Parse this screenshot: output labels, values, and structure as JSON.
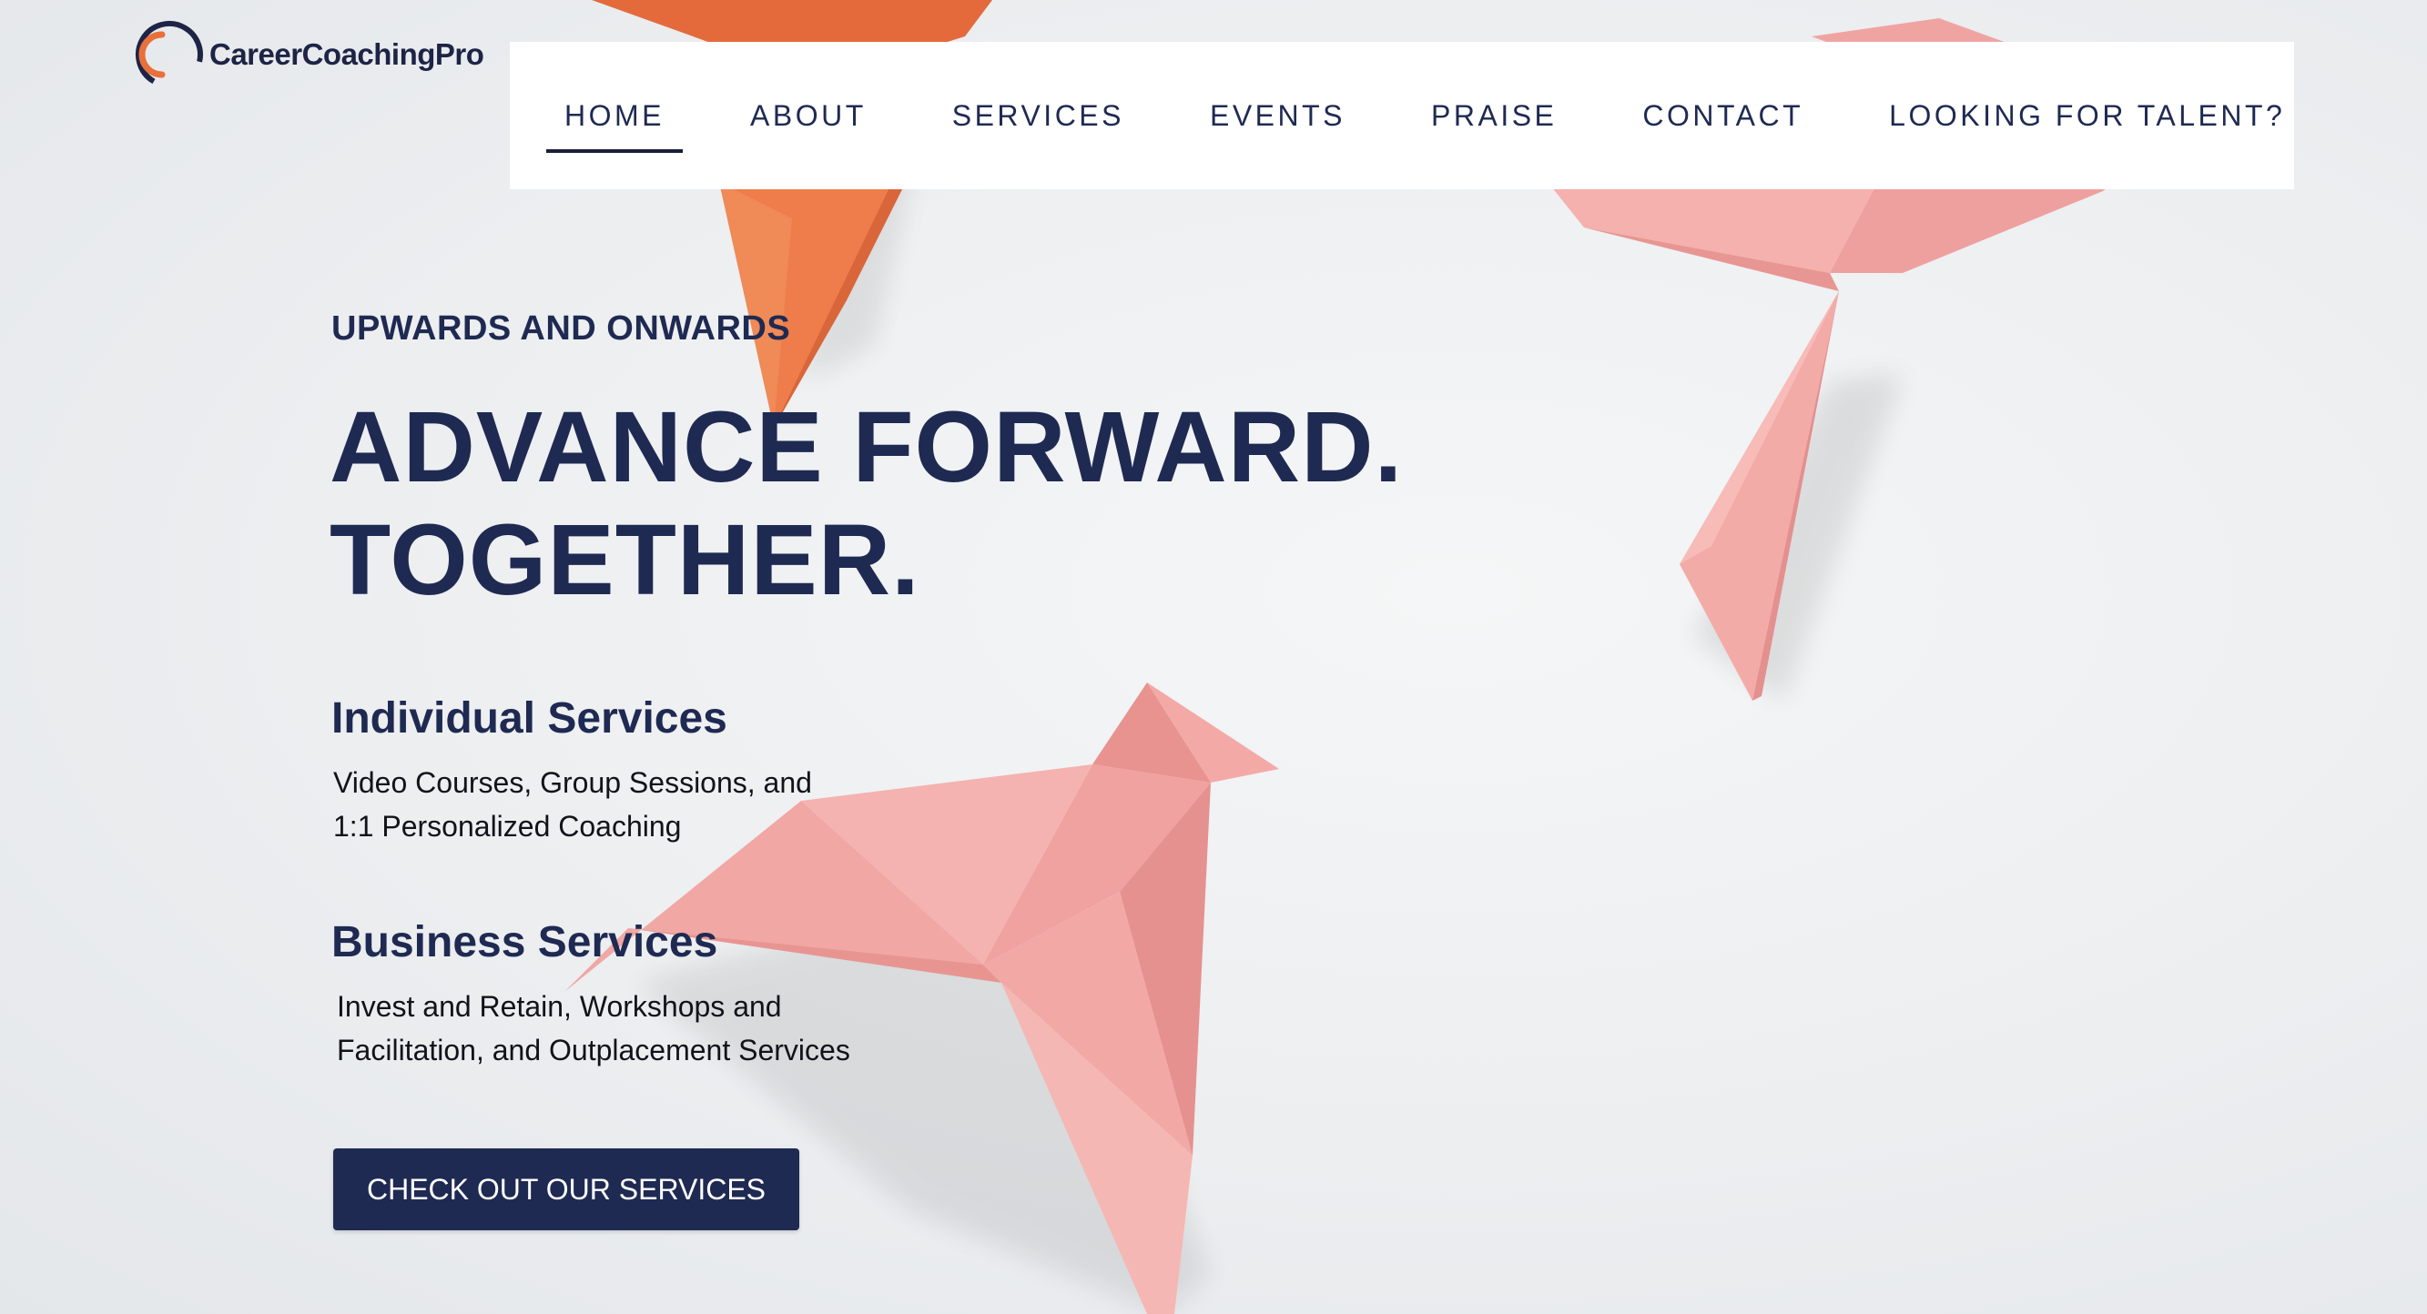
{
  "brand": {
    "name": "CareerCoachingPro",
    "mark_colors": {
      "outer": "#1e2445",
      "inner": "#e8703a"
    }
  },
  "nav": {
    "items": [
      {
        "label": "HOME",
        "active": true
      },
      {
        "label": "ABOUT",
        "active": false
      },
      {
        "label": "SERVICES",
        "active": false
      },
      {
        "label": "EVENTS",
        "active": false
      },
      {
        "label": "PRAISE",
        "active": false
      },
      {
        "label": "CONTACT",
        "active": false
      },
      {
        "label": "LOOKING FOR TALENT?",
        "active": false
      }
    ]
  },
  "hero": {
    "eyebrow": "UPWARDS AND ONWARDS",
    "headline_line1": "ADVANCE FORWARD.",
    "headline_line2": "TOGETHER.",
    "individual": {
      "title": "Individual Services",
      "desc_line1": "Video Courses, Group Sessions, and",
      "desc_line2": "1:1 Personalized Coaching"
    },
    "business": {
      "title": "Business Services",
      "desc_line1": "Invest and Retain, Workshops and",
      "desc_line2": "Facilitation, and Outplacement Services"
    },
    "cta_label": "CHECK OUT OUR SERVICES"
  },
  "colors": {
    "navy": "#1f2a52",
    "origami_orange": "#ee7a4a",
    "origami_pink": "#f2a5a3"
  },
  "background_image": "origami-birds-image"
}
